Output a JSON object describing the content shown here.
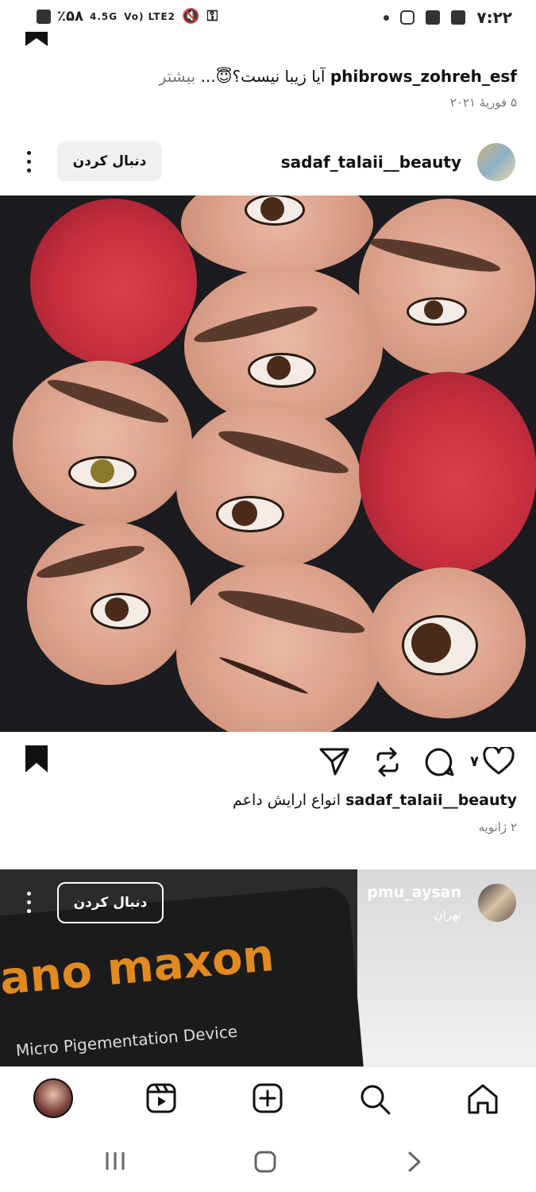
{
  "status_bar": {
    "battery": "٪۵۸",
    "network_1": "4.5G",
    "network_2": "Vo) LTE2",
    "time": "۷:۲۲"
  },
  "previous_post": {
    "username": "phibrows_zohreh_esf",
    "caption": "آیا زیبا نیست؟😇...",
    "more_label": "بیشتر",
    "date": "۵ فوریهٔ ۲۰۲۱"
  },
  "post": {
    "username": "sadaf_talaii__beauty",
    "follow_label": "دنبال کردن",
    "likes": "۷",
    "caption_user": "sadaf_talaii__beauty",
    "caption_text": "انواع ارایش داعم",
    "date": "۲ ژانویه"
  },
  "reel": {
    "username": "pmu_aysan",
    "location": "تهران",
    "follow_label": "دنبال کردن",
    "brand_text": "ano maxon",
    "device_text": "Micro Pigementation Device"
  },
  "nav": {
    "items": [
      "home-icon",
      "search-icon",
      "create-icon",
      "reels-icon",
      "profile-avatar"
    ]
  },
  "colors": {
    "follow_btn_bg": "#eff0f2",
    "icon_color": "#111111",
    "muted_text": "#777777"
  }
}
